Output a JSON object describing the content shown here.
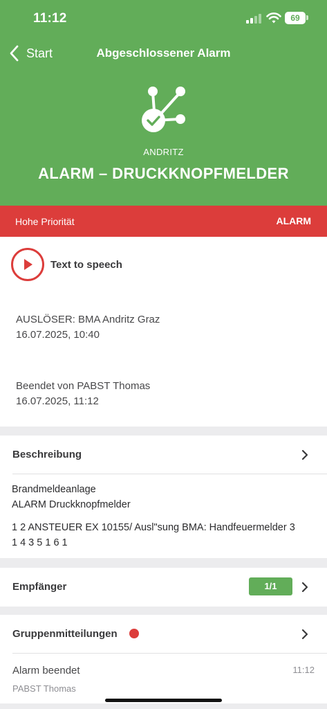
{
  "status_bar": {
    "time": "11:12",
    "battery": "69"
  },
  "nav": {
    "back_label": "Start",
    "title": "Abgeschlossener Alarm"
  },
  "alarm": {
    "organization": "ANDRITZ",
    "title": "ALARM – DRUCKKNOPFMELDER",
    "priority_label": "Hohe Priorität",
    "type": "ALARM"
  },
  "tts": {
    "label": "Text to speech"
  },
  "trigger": {
    "line": "AUSLÖSER: BMA Andritz Graz",
    "datetime": "16.07.2025, 10:40"
  },
  "ended": {
    "line": "Beendet von PABST Thomas",
    "datetime": "16.07.2025, 11:12"
  },
  "description": {
    "header": "Beschreibung",
    "line1": "Brandmeldeanlage",
    "line2": "ALARM Druckknopfmelder",
    "line3": "1 2 ANSTEUER EX 10155/ Ausl\"sung BMA: Handfeuermelder 3",
    "line4": "1 4 3 5 1 6 1"
  },
  "recipients": {
    "header": "Empfänger",
    "count": "1/1"
  },
  "group_messages": {
    "header": "Gruppenmitteilungen",
    "items": [
      {
        "title": "Alarm beendet",
        "time": "11:12",
        "author": "PABST Thomas"
      }
    ]
  },
  "colors": {
    "brand_green": "#62ad59",
    "alarm_red": "#dc3d3b"
  },
  "icons": [
    "back-chevron-icon",
    "signal-icon",
    "wifi-icon",
    "battery-icon",
    "alarm-network-check-icon",
    "play-icon",
    "chevron-right-icon",
    "unread-dot-icon"
  ]
}
